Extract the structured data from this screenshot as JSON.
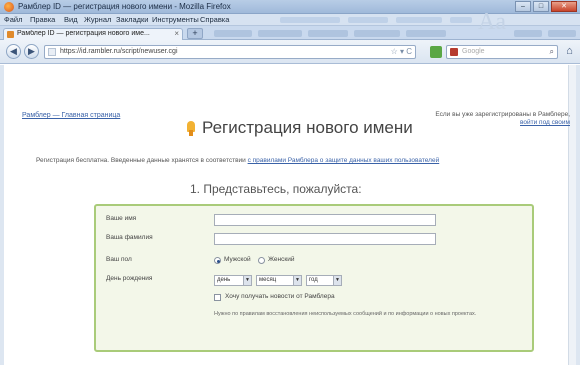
{
  "window": {
    "title": "Рамблер ID — регистрация нового имени - Mozilla Firefox",
    "controls": [
      "–",
      "□",
      "✕"
    ]
  },
  "menubar": {
    "items": [
      "Файл",
      "Правка",
      "Вид",
      "Журнал",
      "Закладки",
      "Инструменты",
      "Справка"
    ]
  },
  "tabs": {
    "active_label": "Рамблер ID — регистрация нового име...",
    "close": "×",
    "new_tab": "+",
    "big_letter": "Aa"
  },
  "navbar": {
    "back": "◀",
    "forward": "▶",
    "url": "https://id.rambler.ru/script/newuser.cgi",
    "url_buttons": "☆ ▾ C",
    "search_placeholder": "Google",
    "search_go": "⌕",
    "home": "⌂"
  },
  "page": {
    "breadcrumb": "Рамблер — Главная страница",
    "right_note": "Если вы уже зарегистрированы в Рамблере,",
    "right_link": "войти под своим",
    "heading": "Регистрация нового имени",
    "intro": "Регистрация бесплатна. Введенные данные хранятся в соответствии ",
    "intro_link": "с правилами Рамблера о защите данных ваших пользователей",
    "step": "1. Представьтесь, пожалуйста:",
    "form": {
      "first_name_label": "Ваше имя",
      "first_name_value": "",
      "last_name_label": "Ваша фамилия",
      "last_name_value": "",
      "gender_label": "Ваш пол",
      "gender_options": [
        "Мужской",
        "Женский"
      ],
      "gender_selected": "Мужской",
      "birthday_label": "День рождения",
      "day": "день",
      "month": "месяц",
      "year": "год",
      "select_arrow": "▼",
      "news_checkbox_label": "Хочу получать новости от Рамблера",
      "news_checked": false,
      "note": "Нужно по правилам восстановления неиспользуемых сообщений и по информации о новых проектах."
    }
  },
  "colors": {
    "form_border": "#a9cb79",
    "form_bg": "#f3f7e9",
    "link": "#3a62a8",
    "accent": "#f2b233"
  }
}
